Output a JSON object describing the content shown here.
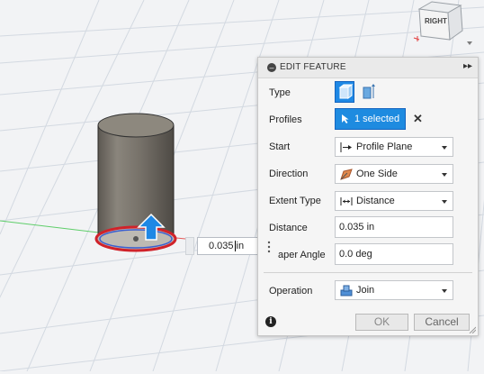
{
  "viewcube": {
    "face_label": "RIGHT"
  },
  "canvas": {
    "distance_input_value": "0.035",
    "distance_input_unit": "in"
  },
  "dialog": {
    "title": "EDIT FEATURE",
    "rows": {
      "type_label": "Type",
      "profiles_label": "Profiles",
      "profiles_value": "1 selected",
      "start_label": "Start",
      "start_value": "Profile Plane",
      "direction_label": "Direction",
      "direction_value": "One Side",
      "extent_label": "Extent Type",
      "extent_value": "Distance",
      "distance_label": "Distance",
      "distance_value": "0.035 in",
      "taper_label": "aper Angle",
      "taper_value": "0.0 deg",
      "operation_label": "Operation",
      "operation_value": "Join"
    },
    "ok_label": "OK",
    "cancel_label": "Cancel"
  },
  "colors": {
    "accent": "#1e88e5",
    "grid": "#cfd8e3",
    "cylinder": "#6f6a62",
    "profile_red": "#d0222a",
    "profile_blue": "#3a5fd0"
  },
  "icons": [
    "viewcube-icon",
    "extrude-solid-icon",
    "extrude-surface-icon",
    "select-arrow-icon",
    "close-icon",
    "profile-plane-icon",
    "one-side-icon",
    "distance-extent-icon",
    "join-icon",
    "info-icon",
    "drag-dots-icon",
    "chevron-right-double-icon",
    "minus-circle-icon"
  ]
}
